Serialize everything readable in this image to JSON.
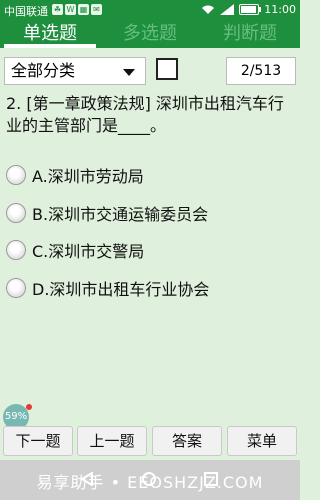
{
  "status_bar": {
    "carrier": "中国联通",
    "mini_icons": [
      "☘",
      "W",
      "▦",
      "✉"
    ],
    "time": "11:00"
  },
  "tabs": [
    {
      "label": "单选题",
      "active": true
    },
    {
      "label": "多选题",
      "active": false
    },
    {
      "label": "判断题",
      "active": false
    }
  ],
  "toolbar": {
    "category_value": "全部分类",
    "progress": "2/513"
  },
  "question": {
    "text": "2. [第一章政策法规] 深圳市出租汽车行业的主管部门是____。"
  },
  "options": [
    {
      "label": "A.深圳市劳动局"
    },
    {
      "label": "B.深圳市交通运输委员会"
    },
    {
      "label": "C.深圳市交警局"
    },
    {
      "label": "D.深圳市出租车行业协会"
    }
  ],
  "badge": {
    "text": "59%"
  },
  "actions": {
    "next": "下一题",
    "prev": "上一题",
    "answer": "答案",
    "menu": "菜单"
  },
  "nav": {
    "watermark": "易享助手 • EEOSHZJZ.COM"
  },
  "colors": {
    "primary": "#1e8f3d",
    "background": "#dff0dc"
  }
}
